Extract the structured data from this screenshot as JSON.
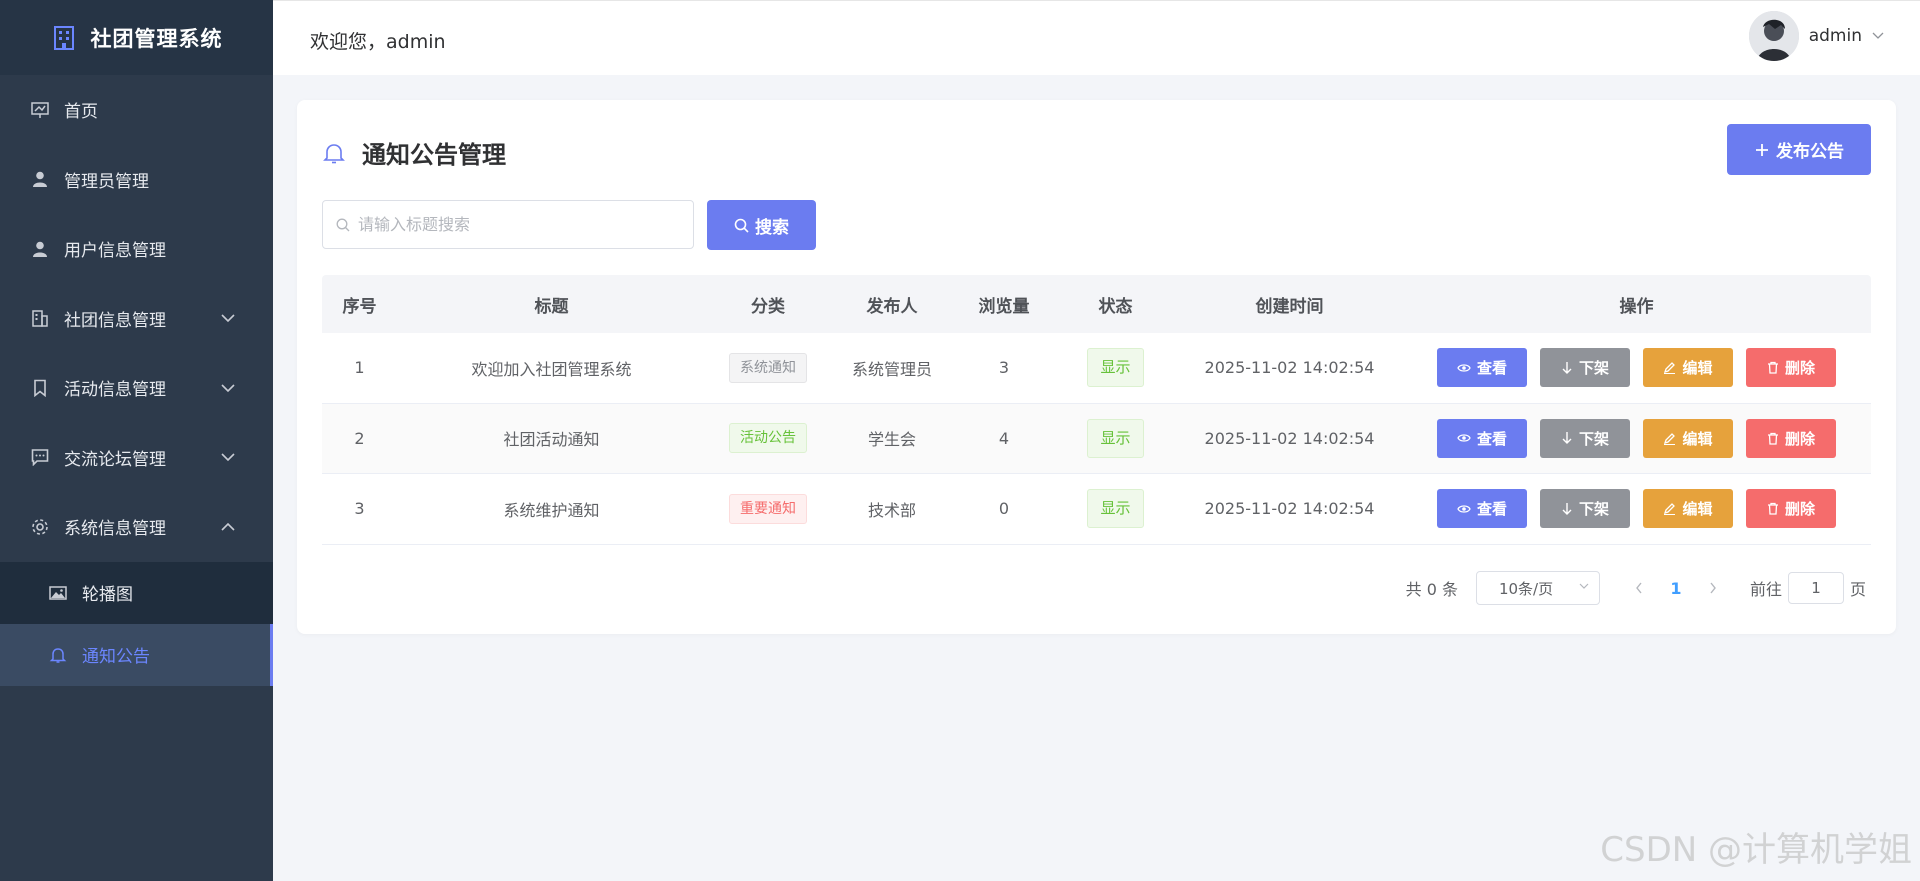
{
  "brand": {
    "title": "社团管理系统"
  },
  "sidebar": {
    "items": [
      {
        "label": "首页",
        "icon": "presentation-icon"
      },
      {
        "label": "管理员管理",
        "icon": "user-icon"
      },
      {
        "label": "用户信息管理",
        "icon": "user-icon"
      },
      {
        "label": "社团信息管理",
        "icon": "building-icon",
        "expandable": true
      },
      {
        "label": "活动信息管理",
        "icon": "bookmark-icon",
        "expandable": true
      },
      {
        "label": "交流论坛管理",
        "icon": "chat-icon",
        "expandable": true
      },
      {
        "label": "系统信息管理",
        "icon": "gear-icon",
        "expanded": true
      }
    ],
    "subitems": [
      {
        "label": "轮播图",
        "icon": "picture-icon"
      },
      {
        "label": "通知公告",
        "icon": "bell-icon",
        "active": true
      }
    ]
  },
  "header": {
    "welcome": "欢迎您，admin",
    "username": "admin"
  },
  "page": {
    "title": "通知公告管理",
    "publish_label": "发布公告",
    "search_placeholder": "请输入标题搜索",
    "search_label": "搜索"
  },
  "table": {
    "columns": [
      "序号",
      "标题",
      "分类",
      "发布人",
      "浏览量",
      "状态",
      "创建时间",
      "操作"
    ],
    "rows": [
      {
        "index": "1",
        "title": "欢迎加入社团管理系统",
        "category": "系统通知",
        "category_type": "info",
        "publisher": "系统管理员",
        "views": "3",
        "status": "显示",
        "created": "2025-11-02 14:02:54"
      },
      {
        "index": "2",
        "title": "社团活动通知",
        "category": "活动公告",
        "category_type": "success",
        "publisher": "学生会",
        "views": "4",
        "status": "显示",
        "created": "2025-11-02 14:02:54"
      },
      {
        "index": "3",
        "title": "系统维护通知",
        "category": "重要通知",
        "category_type": "danger",
        "publisher": "技术部",
        "views": "0",
        "status": "显示",
        "created": "2025-11-02 14:02:54"
      }
    ],
    "actions": {
      "view": "查看",
      "down": "下架",
      "edit": "编辑",
      "delete": "删除"
    }
  },
  "pagination": {
    "total": "共 0 条",
    "page_size": "10条/页",
    "current_page": "1",
    "goto_label": "前往",
    "goto_value": "1",
    "goto_suffix": "页"
  },
  "watermark": "CSDN @计算机学姐",
  "colors": {
    "primary": "#6b7cf0",
    "sidebar": "#2d3a4b",
    "info": "#909399",
    "warning": "#e6a23c",
    "danger": "#f56c6c",
    "success": "#67c23a"
  }
}
